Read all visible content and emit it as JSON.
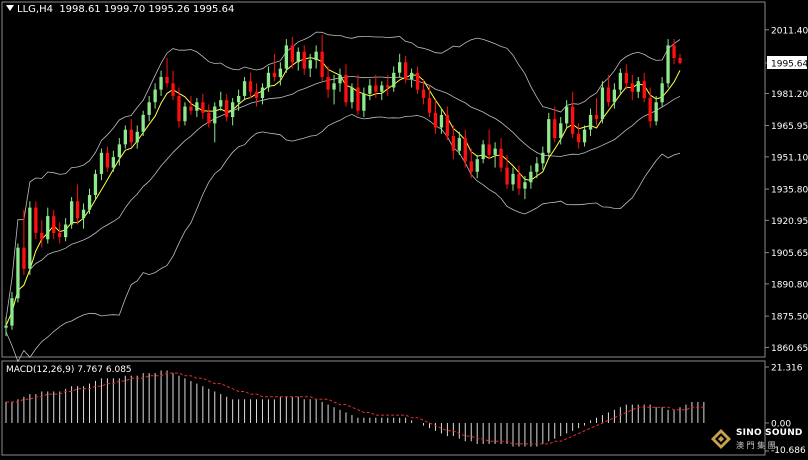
{
  "header": {
    "symbol": "LLG,H4",
    "open": "1998.61",
    "high": "1999.70",
    "low": "1995.26",
    "close": "1995.64"
  },
  "macd": {
    "label": "MACD(12,26,9)",
    "main": "7.767",
    "signal": "6.085",
    "axis_top": "21.316",
    "axis_zero": "0.00",
    "axis_bottom": "-10.686"
  },
  "logo": {
    "brand": "SINO SOUND",
    "brand_cn": "澳 門 集 團"
  },
  "colors": {
    "background": "#000000",
    "bull": "#8ee88e",
    "bear": "#ff1010",
    "ma": "#ffff40",
    "band": "#bdbdbd",
    "signal": "#e03030",
    "current_label_bg": "#ffffff"
  },
  "chart_data": {
    "type": "candlestick",
    "price_axis": {
      "ticks": [
        "2011.40",
        "1995.64",
        "1981.20",
        "1965.95",
        "1951.10",
        "1935.80",
        "1920.95",
        "1905.65",
        "1890.80",
        "1875.50",
        "1860.65"
      ],
      "ylim": [
        1858,
        2017
      ],
      "current": "1995.64"
    },
    "candles": [
      [
        1870,
        1875,
        1866,
        1871
      ],
      [
        1871,
        1887,
        1869,
        1884
      ],
      [
        1884,
        1910,
        1882,
        1908
      ],
      [
        1908,
        1926,
        1895,
        1898
      ],
      [
        1898,
        1930,
        1895,
        1927
      ],
      [
        1927,
        1930,
        1912,
        1915
      ],
      [
        1915,
        1921,
        1908,
        1912
      ],
      [
        1912,
        1927,
        1910,
        1923
      ],
      [
        1923,
        1926,
        1912,
        1915
      ],
      [
        1915,
        1920,
        1910,
        1913
      ],
      [
        1913,
        1922,
        1911,
        1919
      ],
      [
        1919,
        1932,
        1917,
        1930
      ],
      [
        1930,
        1938,
        1919,
        1922
      ],
      [
        1922,
        1929,
        1917,
        1926
      ],
      [
        1926,
        1936,
        1924,
        1933
      ],
      [
        1933,
        1945,
        1931,
        1943
      ],
      [
        1943,
        1955,
        1940,
        1953
      ],
      [
        1953,
        1956,
        1944,
        1946
      ],
      [
        1946,
        1954,
        1944,
        1951
      ],
      [
        1951,
        1960,
        1947,
        1957
      ],
      [
        1957,
        1966,
        1955,
        1964
      ],
      [
        1964,
        1969,
        1956,
        1958
      ],
      [
        1958,
        1966,
        1955,
        1963
      ],
      [
        1963,
        1973,
        1961,
        1971
      ],
      [
        1971,
        1980,
        1968,
        1977
      ],
      [
        1977,
        1986,
        1974,
        1983
      ],
      [
        1983,
        1992,
        1980,
        1989
      ],
      [
        1989,
        1998,
        1984,
        1986
      ],
      [
        1986,
        1992,
        1978,
        1980
      ],
      [
        1980,
        1984,
        1965,
        1968
      ],
      [
        1968,
        1977,
        1966,
        1975
      ],
      [
        1975,
        1980,
        1971,
        1973
      ],
      [
        1973,
        1979,
        1970,
        1977
      ],
      [
        1977,
        1981,
        1969,
        1972
      ],
      [
        1972,
        1976,
        1965,
        1967
      ],
      [
        1967,
        1977,
        1958,
        1975
      ],
      [
        1975,
        1982,
        1973,
        1978
      ],
      [
        1978,
        1981,
        1968,
        1970
      ],
      [
        1970,
        1979,
        1966,
        1977
      ],
      [
        1977,
        1983,
        1973,
        1980
      ],
      [
        1980,
        1989,
        1978,
        1987
      ],
      [
        1987,
        1991,
        1979,
        1982
      ],
      [
        1982,
        1986,
        1975,
        1979
      ],
      [
        1979,
        1986,
        1976,
        1984
      ],
      [
        1984,
        1994,
        1982,
        1991
      ],
      [
        1991,
        2000,
        1987,
        1989
      ],
      [
        1989,
        1996,
        1985,
        1993
      ],
      [
        1993,
        2007,
        1991,
        2004
      ],
      [
        2004,
        2008,
        1993,
        1996
      ],
      [
        1996,
        2003,
        1992,
        2001
      ],
      [
        2001,
        2004,
        1990,
        1993
      ],
      [
        1993,
        2000,
        1989,
        1997
      ],
      [
        1997,
        2004,
        1993,
        2001
      ],
      [
        2001,
        2009,
        1987,
        1989
      ],
      [
        1989,
        1994,
        1979,
        1983
      ],
      [
        1983,
        1990,
        1976,
        1986
      ],
      [
        1986,
        1993,
        1982,
        1990
      ],
      [
        1990,
        1995,
        1975,
        1977
      ],
      [
        1977,
        1986,
        1974,
        1984
      ],
      [
        1984,
        1990,
        1971,
        1973
      ],
      [
        1973,
        1984,
        1970,
        1981
      ],
      [
        1981,
        1988,
        1978,
        1985
      ],
      [
        1985,
        1990,
        1979,
        1982
      ],
      [
        1982,
        1987,
        1978,
        1985
      ],
      [
        1985,
        1990,
        1980,
        1984
      ],
      [
        1984,
        1994,
        1982,
        1991
      ],
      [
        1991,
        2000,
        1989,
        1996
      ],
      [
        1996,
        1999,
        1986,
        1988
      ],
      [
        1988,
        1993,
        1984,
        1991
      ],
      [
        1991,
        1994,
        1981,
        1983
      ],
      [
        1983,
        1988,
        1976,
        1979
      ],
      [
        1979,
        1985,
        1970,
        1972
      ],
      [
        1972,
        1978,
        1962,
        1965
      ],
      [
        1965,
        1974,
        1962,
        1971
      ],
      [
        1971,
        1975,
        1959,
        1961
      ],
      [
        1961,
        1966,
        1950,
        1954
      ],
      [
        1954,
        1963,
        1952,
        1960
      ],
      [
        1960,
        1964,
        1946,
        1949
      ],
      [
        1949,
        1955,
        1941,
        1944
      ],
      [
        1944,
        1952,
        1941,
        1950
      ],
      [
        1950,
        1959,
        1948,
        1957
      ],
      [
        1957,
        1964,
        1950,
        1952
      ],
      [
        1952,
        1958,
        1946,
        1955
      ],
      [
        1955,
        1960,
        1944,
        1946
      ],
      [
        1946,
        1952,
        1936,
        1938
      ],
      [
        1938,
        1946,
        1935,
        1943
      ],
      [
        1943,
        1947,
        1933,
        1936
      ],
      [
        1936,
        1942,
        1931,
        1939
      ],
      [
        1939,
        1947,
        1936,
        1944
      ],
      [
        1944,
        1951,
        1941,
        1948
      ],
      [
        1948,
        1956,
        1945,
        1953
      ],
      [
        1953,
        1972,
        1951,
        1969
      ],
      [
        1969,
        1975,
        1958,
        1960
      ],
      [
        1960,
        1970,
        1957,
        1967
      ],
      [
        1967,
        1978,
        1965,
        1975
      ],
      [
        1975,
        1982,
        1960,
        1962
      ],
      [
        1962,
        1967,
        1955,
        1958
      ],
      [
        1958,
        1966,
        1956,
        1964
      ],
      [
        1964,
        1974,
        1961,
        1971
      ],
      [
        1971,
        1979,
        1966,
        1969
      ],
      [
        1969,
        1987,
        1967,
        1984
      ],
      [
        1984,
        1990,
        1975,
        1977
      ],
      [
        1977,
        1986,
        1974,
        1983
      ],
      [
        1983,
        1993,
        1981,
        1991
      ],
      [
        1991,
        1995,
        1983,
        1986
      ],
      [
        1986,
        1990,
        1978,
        1982
      ],
      [
        1982,
        1989,
        1979,
        1987
      ],
      [
        1987,
        1991,
        1977,
        1979
      ],
      [
        1979,
        1984,
        1965,
        1968
      ],
      [
        1968,
        1980,
        1966,
        1977
      ],
      [
        1977,
        1989,
        1975,
        1986
      ],
      [
        1986,
        2007,
        1984,
        2004
      ],
      [
        2004,
        2007,
        1995,
        1998
      ],
      [
        1998,
        2000,
        1995,
        1995.64
      ]
    ],
    "macd": {
      "ylim": [
        -10.686,
        21.316
      ],
      "hist": [
        8,
        8,
        9,
        10,
        11,
        11,
        12,
        12,
        12,
        12,
        13,
        14,
        14,
        14,
        15,
        16,
        17,
        17,
        17,
        17,
        18,
        18,
        18,
        19,
        19,
        19,
        20,
        20,
        19,
        18,
        17,
        16,
        15,
        14,
        13,
        12,
        11,
        10,
        9,
        9,
        9,
        9,
        9,
        9,
        9,
        9,
        10,
        10,
        10,
        10,
        9,
        9,
        9,
        8,
        7,
        6,
        5,
        4,
        3,
        2,
        2,
        2,
        2,
        2,
        2,
        2,
        2,
        2,
        1,
        0,
        -1,
        -2,
        -3,
        -4,
        -5,
        -5,
        -6,
        -7,
        -7,
        -8,
        -8,
        -8,
        -8,
        -8,
        -8,
        -9,
        -9,
        -9,
        -9,
        -9,
        -8,
        -7,
        -6,
        -5,
        -4,
        -3,
        -2,
        -1,
        1,
        2,
        3,
        4,
        5,
        6,
        7,
        7,
        7,
        7,
        7,
        6,
        6,
        5,
        5,
        6,
        7,
        8,
        8,
        8
      ],
      "signal": [
        8,
        8,
        8,
        9,
        9,
        10,
        10,
        11,
        11,
        11,
        12,
        12,
        13,
        13,
        13,
        14,
        14,
        15,
        15,
        16,
        16,
        17,
        17,
        17,
        18,
        18,
        18,
        19,
        19,
        19,
        18,
        18,
        17,
        17,
        16,
        15,
        15,
        14,
        13,
        12,
        12,
        11,
        11,
        10,
        10,
        10,
        10,
        10,
        10,
        10,
        10,
        10,
        9,
        9,
        9,
        8,
        7,
        7,
        6,
        5,
        4,
        4,
        3,
        3,
        3,
        3,
        3,
        3,
        2,
        2,
        1,
        0,
        -1,
        -2,
        -3,
        -3,
        -4,
        -5,
        -5,
        -6,
        -6,
        -7,
        -7,
        -7,
        -7,
        -8,
        -8,
        -8,
        -8,
        -8,
        -8,
        -8,
        -7,
        -7,
        -6,
        -5,
        -4,
        -3,
        -2,
        -1,
        0,
        1,
        2,
        3,
        4,
        5,
        6,
        6,
        6,
        6,
        6,
        6,
        5,
        5,
        5,
        6,
        6,
        6
      ]
    },
    "grid": false,
    "legend": "none"
  }
}
